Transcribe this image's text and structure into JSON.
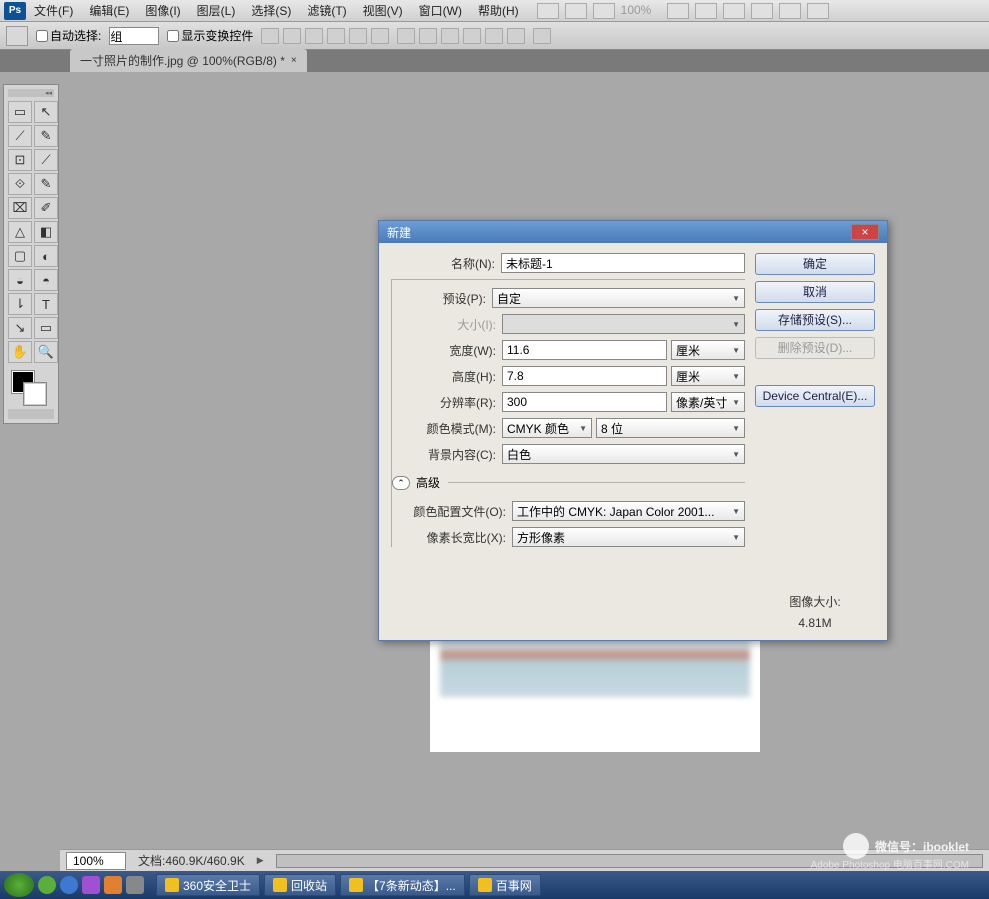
{
  "menubar": {
    "items": [
      "文件(F)",
      "编辑(E)",
      "图像(I)",
      "图层(L)",
      "选择(S)",
      "滤镜(T)",
      "视图(V)",
      "窗口(W)",
      "帮助(H)"
    ],
    "zoom": "100%"
  },
  "optionsbar": {
    "auto_select": "自动选择:",
    "group": "组",
    "show_transform": "显示变换控件"
  },
  "document": {
    "tab_title": "一寸照片的制作.jpg @ 100%(RGB/8) *"
  },
  "tools": [
    "▭",
    "↖",
    "⟋",
    "✎",
    "⊡",
    "⟋",
    "⟐",
    "✎",
    "⌧",
    "✐",
    "△",
    "◧",
    "▢",
    "◐",
    "◒",
    "◓",
    "⇂",
    "T",
    "↘",
    "▭",
    "✋",
    "🔍"
  ],
  "colors": {
    "fg": "#000000",
    "bg": "#ffffff"
  },
  "status": {
    "zoom": "100%",
    "doc": "文档:460.9K/460.9K"
  },
  "dialog": {
    "title": "新建",
    "name_label": "名称(N):",
    "name_value": "未标题-1",
    "preset_label": "预设(P):",
    "preset_value": "自定",
    "size_label": "大小(I):",
    "width_label": "宽度(W):",
    "width_value": "11.6",
    "width_unit": "厘米",
    "height_label": "高度(H):",
    "height_value": "7.8",
    "height_unit": "厘米",
    "resolution_label": "分辨率(R):",
    "resolution_value": "300",
    "resolution_unit": "像素/英寸",
    "color_mode_label": "颜色模式(M):",
    "color_mode_value": "CMYK 颜色",
    "color_mode_bits": "8 位",
    "bg_content_label": "背景内容(C):",
    "bg_content_value": "白色",
    "advanced": "高级",
    "profile_label": "颜色配置文件(O):",
    "profile_value": "工作中的 CMYK: Japan Color 2001...",
    "pixel_ratio_label": "像素长宽比(X):",
    "pixel_ratio_value": "方形像素",
    "ok": "确定",
    "cancel": "取消",
    "save_preset": "存储预设(S)...",
    "delete_preset": "删除预设(D)...",
    "device_central": "Device Central(E)...",
    "image_size_label": "图像大小:",
    "image_size_value": "4.81M"
  },
  "taskbar": {
    "items": [
      "360安全卫士",
      "回收站",
      "【7条新动态】...",
      "百事网"
    ]
  },
  "watermark": {
    "text": "微信号：ibooklet",
    "sub": "Adobe Photoshop 电脑百事网.COM"
  }
}
